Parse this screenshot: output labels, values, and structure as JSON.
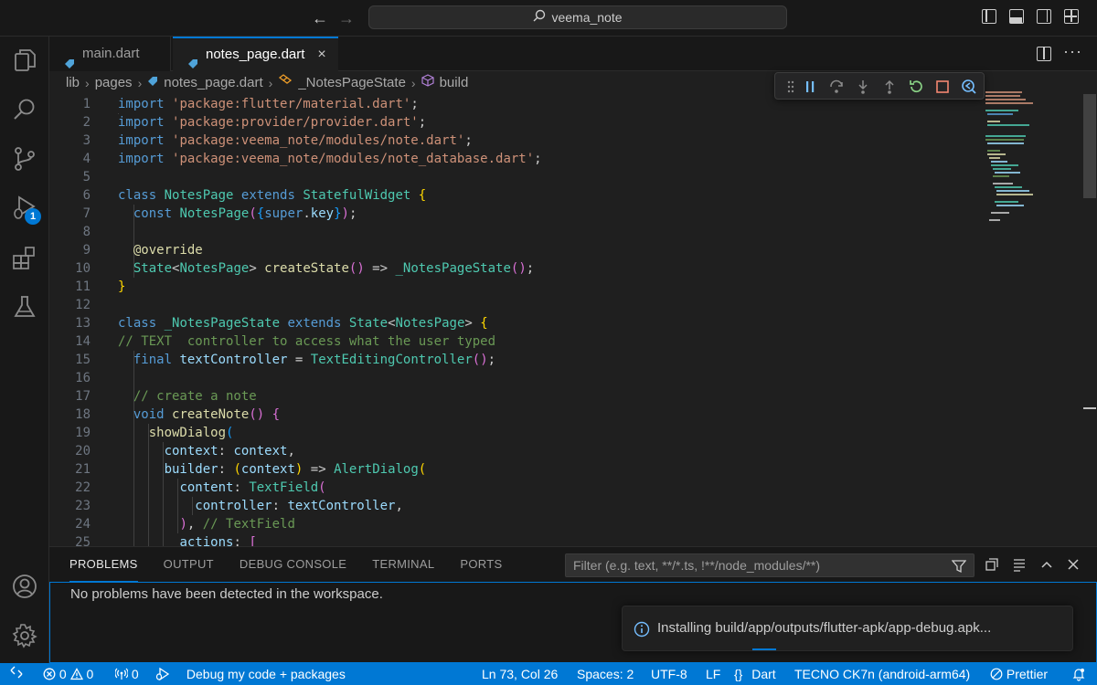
{
  "titlebar": {
    "back_label": "←",
    "forward_label": "→",
    "command_center_label": "veema_note"
  },
  "activity_bar": {
    "debug_badge": "1"
  },
  "tabs": [
    {
      "label": "main.dart",
      "active": false
    },
    {
      "label": "notes_page.dart",
      "active": true,
      "close": "×"
    }
  ],
  "breadcrumb": [
    "lib",
    "pages",
    "notes_page.dart",
    "_NotesPageState",
    "build"
  ],
  "editor": {
    "line_numbers": [
      "1",
      "2",
      "3",
      "4",
      "5",
      "6",
      "7",
      "8",
      "9",
      "10",
      "11",
      "12",
      "13",
      "14",
      "15",
      "16",
      "17",
      "18",
      "19",
      "20",
      "21",
      "22",
      "23",
      "24",
      "25"
    ]
  },
  "panel": {
    "tabs": [
      "PROBLEMS",
      "OUTPUT",
      "DEBUG CONSOLE",
      "TERMINAL",
      "PORTS"
    ],
    "active_tab": "PROBLEMS",
    "filter_placeholder": "Filter (e.g. text, **/*.ts, !**/node_modules/**)",
    "no_problems_message": "No problems have been detected in the workspace."
  },
  "notification": {
    "message": "Installing build/app/outputs/flutter-apk/app-debug.apk..."
  },
  "statusbar": {
    "errors": "0",
    "warnings": "0",
    "ports": "0",
    "debug_config": "Debug my code + packages",
    "cursor_position": "Ln 73, Col 26",
    "indentation": "Spaces: 2",
    "encoding": "UTF-8",
    "eol": "LF",
    "language": "Dart",
    "device": "TECNO CK7n (android-arm64)",
    "formatter": "Prettier"
  },
  "colors": {
    "accent": "#0078d4",
    "editor_bg": "#1f1f1f",
    "sidebar_bg": "#181818",
    "keyword": "#569cd6",
    "string": "#ce9178",
    "class": "#4ec9b0",
    "function": "#dcdcaa",
    "comment": "#6a9955"
  }
}
